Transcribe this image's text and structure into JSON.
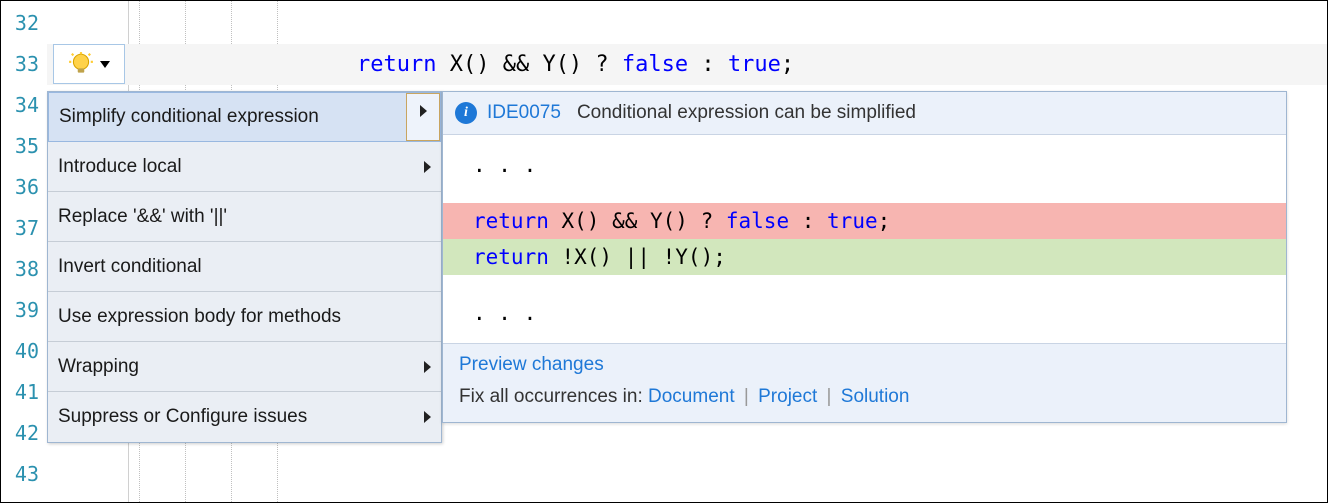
{
  "line_numbers": [
    "32",
    "33",
    "34",
    "35",
    "36",
    "37",
    "38",
    "39",
    "40",
    "41",
    "42",
    "43"
  ],
  "code": {
    "kw_return": "return",
    "expr_mid": " X() && Y() ? ",
    "kw_false": "false",
    "colon": " : ",
    "kw_true": "true",
    "semi": ";"
  },
  "icons": {
    "lightbulb": "lightbulb-icon",
    "info": "info-icon"
  },
  "menu": {
    "items": [
      {
        "label": "Simplify conditional expression",
        "submenu": true,
        "selected": true
      },
      {
        "label": "Introduce local",
        "submenu": true,
        "selected": false
      },
      {
        "label": "Replace '&&' with '||'",
        "submenu": false,
        "selected": false
      },
      {
        "label": "Invert conditional",
        "submenu": false,
        "selected": false
      },
      {
        "label": "Use expression body for methods",
        "submenu": false,
        "selected": false
      },
      {
        "label": "Wrapping",
        "submenu": true,
        "selected": false
      },
      {
        "label": "Suppress or Configure issues",
        "submenu": true,
        "selected": false
      }
    ]
  },
  "preview": {
    "code_id": "IDE0075",
    "desc": "Conditional expression can be simplified",
    "ctx_dots": ". . .",
    "del": {
      "kw": "return",
      "rest": " X() && Y() ? ",
      "kw2": "false",
      "mid": " : ",
      "kw3": "true",
      "end": ";"
    },
    "add": {
      "kw": "return",
      "rest": " !X() || !Y();"
    },
    "preview_link": "Preview changes",
    "fix_label": "Fix all occurrences in: ",
    "fix_doc": "Document",
    "fix_proj": "Project",
    "fix_sol": "Solution"
  },
  "colors": {
    "keyword": "#0000ff",
    "link": "#1e78d7",
    "del_bg": "#f7b5b1",
    "add_bg": "#d2e7bd",
    "panel_bg": "#ebf1fa"
  }
}
